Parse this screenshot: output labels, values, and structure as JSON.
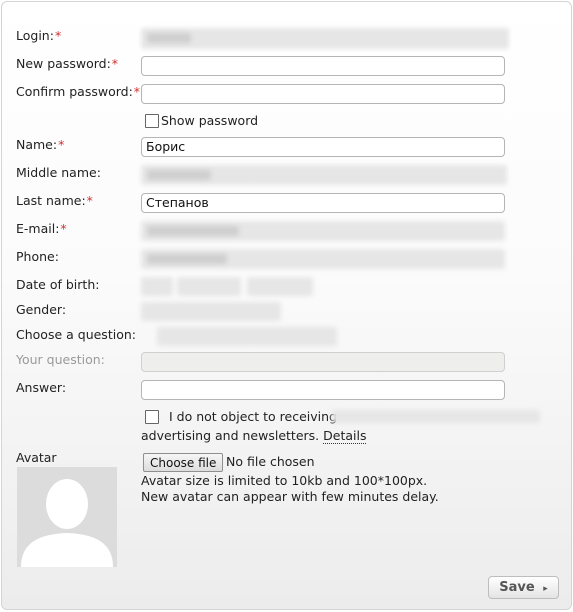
{
  "form": {
    "login": {
      "label": "Login:"
    },
    "new_password": {
      "label": "New password:"
    },
    "confirm_password": {
      "label": "Confirm password:"
    },
    "show_password": {
      "label": "Show password",
      "checked": false
    },
    "name": {
      "label": "Name:",
      "value": "Борис"
    },
    "middle_name": {
      "label": "Middle name:"
    },
    "last_name": {
      "label": "Last name:",
      "value": "Степанов"
    },
    "email": {
      "label": "E-mail:"
    },
    "phone": {
      "label": "Phone:"
    },
    "date_of_birth": {
      "label": "Date of birth:"
    },
    "gender": {
      "label": "Gender:"
    },
    "question": {
      "label": "Choose a question:"
    },
    "your_question": {
      "label": "Your question:"
    },
    "answer": {
      "label": "Answer:"
    },
    "newsletter": {
      "line1": "I do not object to receiving",
      "line2": "advertising and newsletters.",
      "details_link": "Details",
      "checked": false
    },
    "required_mark": "*",
    "avatar": {
      "label": "Avatar",
      "choose_file": "Choose file",
      "no_file": "No file chosen",
      "note1": "Avatar size is limited to 10kb and 100*100px.",
      "note2": "New avatar can appear with few minutes delay."
    },
    "save_label": "Save"
  },
  "colors": {
    "required": "#d0312d",
    "disabled_field": "#eeeeec"
  }
}
